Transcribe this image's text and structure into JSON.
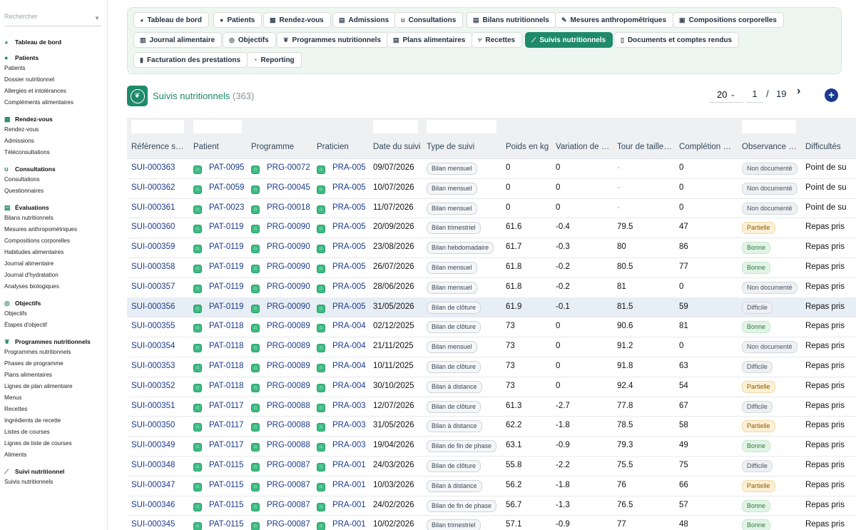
{
  "sidebar": {
    "search_placeholder": "Rechercher",
    "sections": [
      {
        "title": "Tableau de bord",
        "icon": "dashboard-icon",
        "glyph": "◕",
        "items": []
      },
      {
        "title": "Patients",
        "icon": "person-icon",
        "glyph": "●",
        "items": [
          "Patients",
          "Dossier nutritionnel",
          "Allergies et intolérances",
          "Compléments alimentaires"
        ]
      },
      {
        "title": "Rendez-vous",
        "icon": "calendar-icon",
        "glyph": "▦",
        "items": [
          "Rendez-vous",
          "Admissions",
          "Téléconsultations"
        ]
      },
      {
        "title": "Consultations",
        "icon": "stethoscope-icon",
        "glyph": "ʊ",
        "items": [
          "Consultations",
          "Questionnaires"
        ]
      },
      {
        "title": "Évaluations",
        "icon": "clipboard-icon",
        "glyph": "▤",
        "items": [
          "Bilans nutritionnels",
          "Mesures anthropométriques",
          "Compositions corporelles",
          "Habitudes alimentaires",
          "Journal alimentaire",
          "Journal d'hydratation",
          "Analyses biologiques"
        ]
      },
      {
        "title": "Objectifs",
        "icon": "target-icon",
        "glyph": "◎",
        "items": [
          "Objectifs",
          "Étapes d'objectif"
        ]
      },
      {
        "title": "Programmes nutritionnels",
        "icon": "sprout-icon",
        "glyph": "❦",
        "items": [
          "Programmes nutritionnels",
          "Phases de programme",
          "Plans alimentaires",
          "Lignes de plan alimentaire",
          "Menus",
          "Recettes",
          "Ingrédients de recette",
          "Listes de courses",
          "Lignes de liste de courses",
          "Aliments"
        ]
      },
      {
        "title": "Suivi nutritionnel",
        "icon": "chart-line-icon",
        "glyph": "⟋",
        "items": [
          "Suivis nutritionnels"
        ]
      }
    ]
  },
  "menu": [
    {
      "label": "Tableau de bord",
      "icon": "dashboard-icon",
      "glyph": "◕"
    },
    {
      "label": "Patients",
      "icon": "person-icon",
      "glyph": "●"
    },
    {
      "label": "Rendez-vous",
      "icon": "calendar-icon",
      "glyph": "▦"
    },
    {
      "label": "Admissions",
      "icon": "clipboard-icon",
      "glyph": "▤"
    },
    {
      "label": "Consultations",
      "icon": "stethoscope-icon",
      "glyph": "ʊ"
    },
    {
      "label": "Bilans nutritionnels",
      "icon": "clipboard-icon",
      "glyph": "▤"
    },
    {
      "label": "Mesures anthropométriques",
      "icon": "ruler-icon",
      "glyph": "✎"
    },
    {
      "label": "Compositions corporelles",
      "icon": "scale-icon",
      "glyph": "▣"
    },
    {
      "label": "Journal alimentaire",
      "icon": "book-icon",
      "glyph": "▥"
    },
    {
      "label": "Objectifs",
      "icon": "target-icon",
      "glyph": "◎"
    },
    {
      "label": "Programmes nutritionnels",
      "icon": "sprout-icon",
      "glyph": "❦"
    },
    {
      "label": "Plans alimentaires",
      "icon": "clipboard-icon",
      "glyph": "▤"
    },
    {
      "label": "Recettes",
      "icon": "utensils-icon",
      "glyph": "⑂"
    },
    {
      "label": "Suivis nutritionnels",
      "icon": "chart-line-icon",
      "glyph": "⟋",
      "active": true
    },
    {
      "label": "Documents et comptes rendus",
      "icon": "document-icon",
      "glyph": "▯"
    },
    {
      "label": "Facturation des prestations",
      "icon": "invoice-icon",
      "glyph": "▮"
    },
    {
      "label": "Reporting",
      "icon": "pie-chart-icon",
      "glyph": "◔"
    }
  ],
  "page": {
    "title": "Suivis nutritionnels",
    "count": "(363)"
  },
  "pager": {
    "page_size": "20",
    "current": "1",
    "separator": "/",
    "total": "19"
  },
  "table": {
    "columns": [
      "Référence s…",
      "Patient",
      "Programme",
      "Praticien",
      "Date du suivi",
      "Type de suivi",
      "Poids en kg",
      "Variation de …",
      "Tour de taille…",
      "Complétion …",
      "Observance …",
      "Difficultés"
    ],
    "rows": [
      {
        "ref": "SUI-000363",
        "patient": "PAT-0095",
        "programme": "PRG-00072",
        "praticien": "PRA-005",
        "date": "09/07/2026",
        "type": "Bilan mensuel",
        "poids": "0",
        "variation": "0",
        "taille": "-",
        "completion": "0",
        "observance": "Non documenté",
        "obs_class": "nd",
        "difficultes": "Point de su"
      },
      {
        "ref": "SUI-000362",
        "patient": "PAT-0059",
        "programme": "PRG-00045",
        "praticien": "PRA-005",
        "date": "10/07/2026",
        "type": "Bilan mensuel",
        "poids": "0",
        "variation": "0",
        "taille": "-",
        "completion": "0",
        "observance": "Non documenté",
        "obs_class": "nd",
        "difficultes": "Point de su"
      },
      {
        "ref": "SUI-000361",
        "patient": "PAT-0023",
        "programme": "PRG-00018",
        "praticien": "PRA-005",
        "date": "11/07/2026",
        "type": "Bilan mensuel",
        "poids": "0",
        "variation": "0",
        "taille": "-",
        "completion": "0",
        "observance": "Non documenté",
        "obs_class": "nd",
        "difficultes": "Point de su"
      },
      {
        "ref": "SUI-000360",
        "patient": "PAT-0119",
        "programme": "PRG-00090",
        "praticien": "PRA-005",
        "date": "20/09/2026",
        "type": "Bilan trimestriel",
        "poids": "61.6",
        "variation": "-0.4",
        "taille": "79.5",
        "completion": "47",
        "observance": "Partielle",
        "obs_class": "partielle",
        "difficultes": "Repas pris"
      },
      {
        "ref": "SUI-000359",
        "patient": "PAT-0119",
        "programme": "PRG-00090",
        "praticien": "PRA-005",
        "date": "23/08/2026",
        "type": "Bilan hebdomadaire",
        "poids": "61.7",
        "variation": "-0.3",
        "taille": "80",
        "completion": "86",
        "observance": "Bonne",
        "obs_class": "bonne",
        "difficultes": "Repas pris"
      },
      {
        "ref": "SUI-000358",
        "patient": "PAT-0119",
        "programme": "PRG-00090",
        "praticien": "PRA-005",
        "date": "26/07/2026",
        "type": "Bilan mensuel",
        "poids": "61.8",
        "variation": "-0.2",
        "taille": "80.5",
        "completion": "77",
        "observance": "Bonne",
        "obs_class": "bonne",
        "difficultes": "Repas pris"
      },
      {
        "ref": "SUI-000357",
        "patient": "PAT-0119",
        "programme": "PRG-00090",
        "praticien": "PRA-005",
        "date": "28/06/2026",
        "type": "Bilan mensuel",
        "poids": "61.8",
        "variation": "-0.2",
        "taille": "81",
        "completion": "0",
        "observance": "Non documenté",
        "obs_class": "nd",
        "difficultes": "Repas pris"
      },
      {
        "ref": "SUI-000356",
        "patient": "PAT-0119",
        "programme": "PRG-00090",
        "praticien": "PRA-005",
        "date": "31/05/2026",
        "type": "Bilan de clôture",
        "poids": "61.9",
        "variation": "-0.1",
        "taille": "81.5",
        "completion": "59",
        "observance": "Difficile",
        "obs_class": "difficile",
        "difficultes": "Repas pris",
        "highlight": true
      },
      {
        "ref": "SUI-000355",
        "patient": "PAT-0118",
        "programme": "PRG-00089",
        "praticien": "PRA-004",
        "date": "02/12/2025",
        "type": "Bilan de clôture",
        "poids": "73",
        "variation": "0",
        "taille": "90.6",
        "completion": "81",
        "observance": "Bonne",
        "obs_class": "bonne",
        "difficultes": "Repas pris"
      },
      {
        "ref": "SUI-000354",
        "patient": "PAT-0118",
        "programme": "PRG-00089",
        "praticien": "PRA-004",
        "date": "21/11/2025",
        "type": "Bilan mensuel",
        "poids": "73",
        "variation": "0",
        "taille": "91.2",
        "completion": "0",
        "observance": "Non documenté",
        "obs_class": "nd",
        "difficultes": "Repas pris"
      },
      {
        "ref": "SUI-000353",
        "patient": "PAT-0118",
        "programme": "PRG-00089",
        "praticien": "PRA-004",
        "date": "10/11/2025",
        "type": "Bilan de clôture",
        "poids": "73",
        "variation": "0",
        "taille": "91.8",
        "completion": "63",
        "observance": "Difficile",
        "obs_class": "difficile",
        "difficultes": "Repas pris"
      },
      {
        "ref": "SUI-000352",
        "patient": "PAT-0118",
        "programme": "PRG-00089",
        "praticien": "PRA-004",
        "date": "30/10/2025",
        "type": "Bilan à distance",
        "poids": "73",
        "variation": "0",
        "taille": "92.4",
        "completion": "54",
        "observance": "Partielle",
        "obs_class": "partielle",
        "difficultes": "Repas pris"
      },
      {
        "ref": "SUI-000351",
        "patient": "PAT-0117",
        "programme": "PRG-00088",
        "praticien": "PRA-003",
        "date": "12/07/2026",
        "type": "Bilan de clôture",
        "poids": "61.3",
        "variation": "-2.7",
        "taille": "77.8",
        "completion": "67",
        "observance": "Difficile",
        "obs_class": "difficile",
        "difficultes": "Repas pris"
      },
      {
        "ref": "SUI-000350",
        "patient": "PAT-0117",
        "programme": "PRG-00088",
        "praticien": "PRA-003",
        "date": "31/05/2026",
        "type": "Bilan à distance",
        "poids": "62.2",
        "variation": "-1.8",
        "taille": "78.5",
        "completion": "58",
        "observance": "Partielle",
        "obs_class": "partielle",
        "difficultes": "Repas pris"
      },
      {
        "ref": "SUI-000349",
        "patient": "PAT-0117",
        "programme": "PRG-00088",
        "praticien": "PRA-003",
        "date": "19/04/2026",
        "type": "Bilan de fin de phase",
        "poids": "63.1",
        "variation": "-0.9",
        "taille": "79.3",
        "completion": "49",
        "observance": "Bonne",
        "obs_class": "bonne",
        "difficultes": "Repas pris"
      },
      {
        "ref": "SUI-000348",
        "patient": "PAT-0115",
        "programme": "PRG-00087",
        "praticien": "PRA-001",
        "date": "24/03/2026",
        "type": "Bilan de clôture",
        "poids": "55.8",
        "variation": "-2.2",
        "taille": "75.5",
        "completion": "75",
        "observance": "Difficile",
        "obs_class": "difficile",
        "difficultes": "Repas pris"
      },
      {
        "ref": "SUI-000347",
        "patient": "PAT-0115",
        "programme": "PRG-00087",
        "praticien": "PRA-001",
        "date": "10/03/2026",
        "type": "Bilan à distance",
        "poids": "56.2",
        "variation": "-1.8",
        "taille": "76",
        "completion": "66",
        "observance": "Partielle",
        "obs_class": "partielle",
        "difficultes": "Repas pris"
      },
      {
        "ref": "SUI-000346",
        "patient": "PAT-0115",
        "programme": "PRG-00087",
        "praticien": "PRA-001",
        "date": "24/02/2026",
        "type": "Bilan de fin de phase",
        "poids": "56.7",
        "variation": "-1.3",
        "taille": "76.5",
        "completion": "57",
        "observance": "Bonne",
        "obs_class": "bonne",
        "difficultes": "Repas pris"
      },
      {
        "ref": "SUI-000345",
        "patient": "PAT-0115",
        "programme": "PRG-00087",
        "praticien": "PRA-001",
        "date": "10/02/2026",
        "type": "Bilan trimestriel",
        "poids": "57.1",
        "variation": "-0.9",
        "taille": "77",
        "completion": "48",
        "observance": "Bonne",
        "obs_class": "bonne",
        "difficultes": "Repas pris"
      }
    ]
  }
}
